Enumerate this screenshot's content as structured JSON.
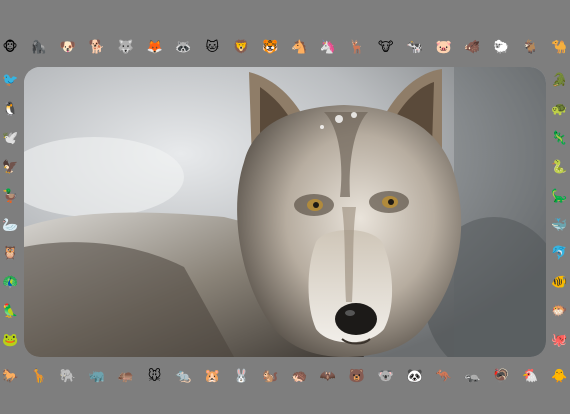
{
  "background_color": "#7e7e7e",
  "photo": {
    "alt": "wolf"
  },
  "emojis": {
    "top": [
      "🐵",
      "🦍",
      "🐶",
      "🐕",
      "🐺",
      "🦊",
      "🦝",
      "🐱",
      "🦁",
      "🐯",
      "🐴",
      "🦄",
      "🦌",
      "🐮",
      "🐄",
      "🐷",
      "🐗",
      "🐑",
      "🐐",
      "🐪"
    ],
    "bottom": [
      "🐎",
      "🦒",
      "🐘",
      "🦏",
      "🦛",
      "🐭",
      "🐀",
      "🐹",
      "🐰",
      "🐿️",
      "🦔",
      "🦇",
      "🐻",
      "🐨",
      "🐼",
      "🦘",
      "🦡",
      "🦃",
      "🐔",
      "🐥"
    ],
    "left": [
      "🐦",
      "🐧",
      "🕊️",
      "🦅",
      "🦆",
      "🦢",
      "🦉",
      "🦚",
      "🦜",
      "🐸"
    ],
    "right": [
      "🐊",
      "🐢",
      "🦎",
      "🐍",
      "🦕",
      "🐳",
      "🐬",
      "🐠",
      "🐡",
      "🐙"
    ]
  }
}
